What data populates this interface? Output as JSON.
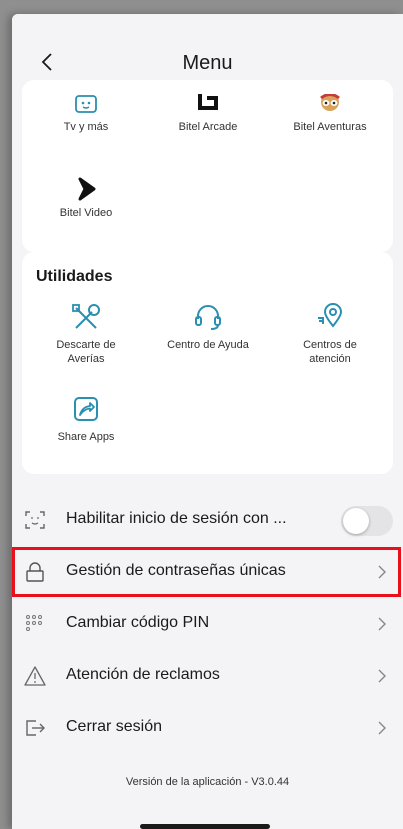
{
  "header": {
    "title": "Menu"
  },
  "entertainment": {
    "items": [
      {
        "label": "Tv y más",
        "icon": "tv-icon"
      },
      {
        "label": "Bitel Arcade",
        "icon": "arcade-icon"
      },
      {
        "label": "Bitel Aventuras",
        "icon": "aventuras-icon"
      },
      {
        "label": "Bitel Video",
        "icon": "video-play-icon"
      }
    ]
  },
  "utilidades": {
    "title": "Utilidades",
    "items": [
      {
        "label_line1": "Descarte de",
        "label_line2": "Averías",
        "icon": "tools-icon"
      },
      {
        "label_line1": "Centro de Ayuda",
        "label_line2": "",
        "icon": "headset-icon"
      },
      {
        "label_line1": "Centros de",
        "label_line2": "atención",
        "icon": "location-pin-icon"
      },
      {
        "label_line1": "Share Apps",
        "label_line2": "",
        "icon": "share-icon"
      }
    ]
  },
  "settings": {
    "items": [
      {
        "label": "Habilitar inicio de sesión con ...",
        "icon": "face-scan-icon",
        "control": "toggle",
        "toggle_on": false
      },
      {
        "label": "Gestión de contraseñas únicas",
        "icon": "lock-icon",
        "control": "chevron",
        "highlighted": true
      },
      {
        "label": "Cambiar código PIN",
        "icon": "pin-keypad-icon",
        "control": "chevron"
      },
      {
        "label": "Atención de reclamos",
        "icon": "warning-icon",
        "control": "chevron"
      },
      {
        "label": "Cerrar sesión",
        "icon": "logout-icon",
        "control": "chevron"
      }
    ]
  },
  "footer": {
    "version": "Versión de la aplicación - V3.0.44"
  },
  "colors": {
    "accent": "#2a8fb0",
    "highlight": "#e8101a",
    "background": "#f4f4f6"
  }
}
